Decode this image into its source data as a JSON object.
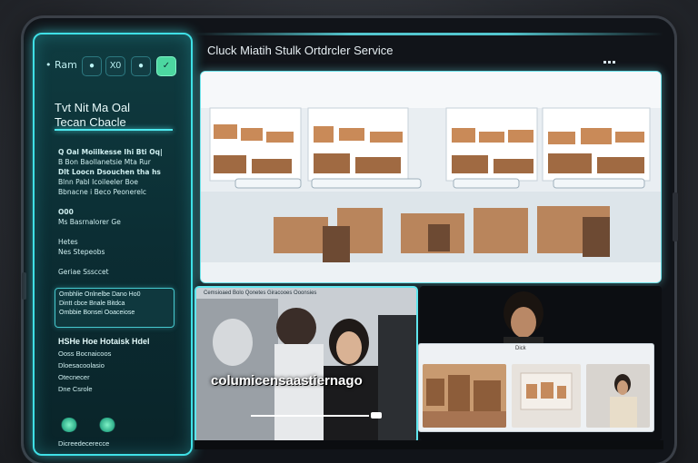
{
  "left_panel": {
    "brand": "• Ram",
    "toolbar": [
      {
        "label": "",
        "icon": "circle-icon",
        "active": false
      },
      {
        "label": "X0",
        "icon": "x-icon",
        "active": false
      },
      {
        "label": "",
        "icon": "circle-icon",
        "active": false
      },
      {
        "label": "",
        "icon": "check-icon",
        "active": true
      }
    ],
    "title": "Tvt Nit Ma Oal",
    "subtitle": "Tecan Cbacle",
    "lines": [
      "Q Oal Moiilkesse Ihi Bti Oq|",
      "B Bon Baollanetsie Mta Rur",
      "Dlt Loocn  Dsouchen tha hs",
      "Blnn Pabl Icoileeler Boe",
      "Bbnacne i Beco Peonerelc",
      "",
      "O00",
      "Ms Basrnalorer Ge",
      "",
      "Hetes",
      "Nes Stepeobs",
      "",
      "Geriae  Sssccet"
    ],
    "card_lines": [
      "Ombhlie  Onlnelbe Dano  Ho0",
      "Dintt cbce Bnale Bitdca",
      "Ombbie Bonsei Ooaceiose"
    ],
    "section_title": "HSHe Hoe Hotaisk Hdel",
    "section_lines": [
      "Ooss Bocnaicoos",
      "Dloesacoolasio",
      "Otecnecer",
      "Dne Csrole"
    ],
    "footer": "Dicreedecerecce"
  },
  "main": {
    "title": "Cluck Miatih Stulk Ortdrcler Service",
    "store_captions": [
      "",
      "",
      "",
      ""
    ],
    "video_top_text": "Cemsioaed Bolo Qonetes Giracooes Ooonsies",
    "video_caption": "columicensaastiernago",
    "thumbs_label": "Dick"
  },
  "colors": {
    "accent": "#3fe0e6",
    "panel_bg": "#0b2b31",
    "active_button": "#4cd7a0"
  }
}
